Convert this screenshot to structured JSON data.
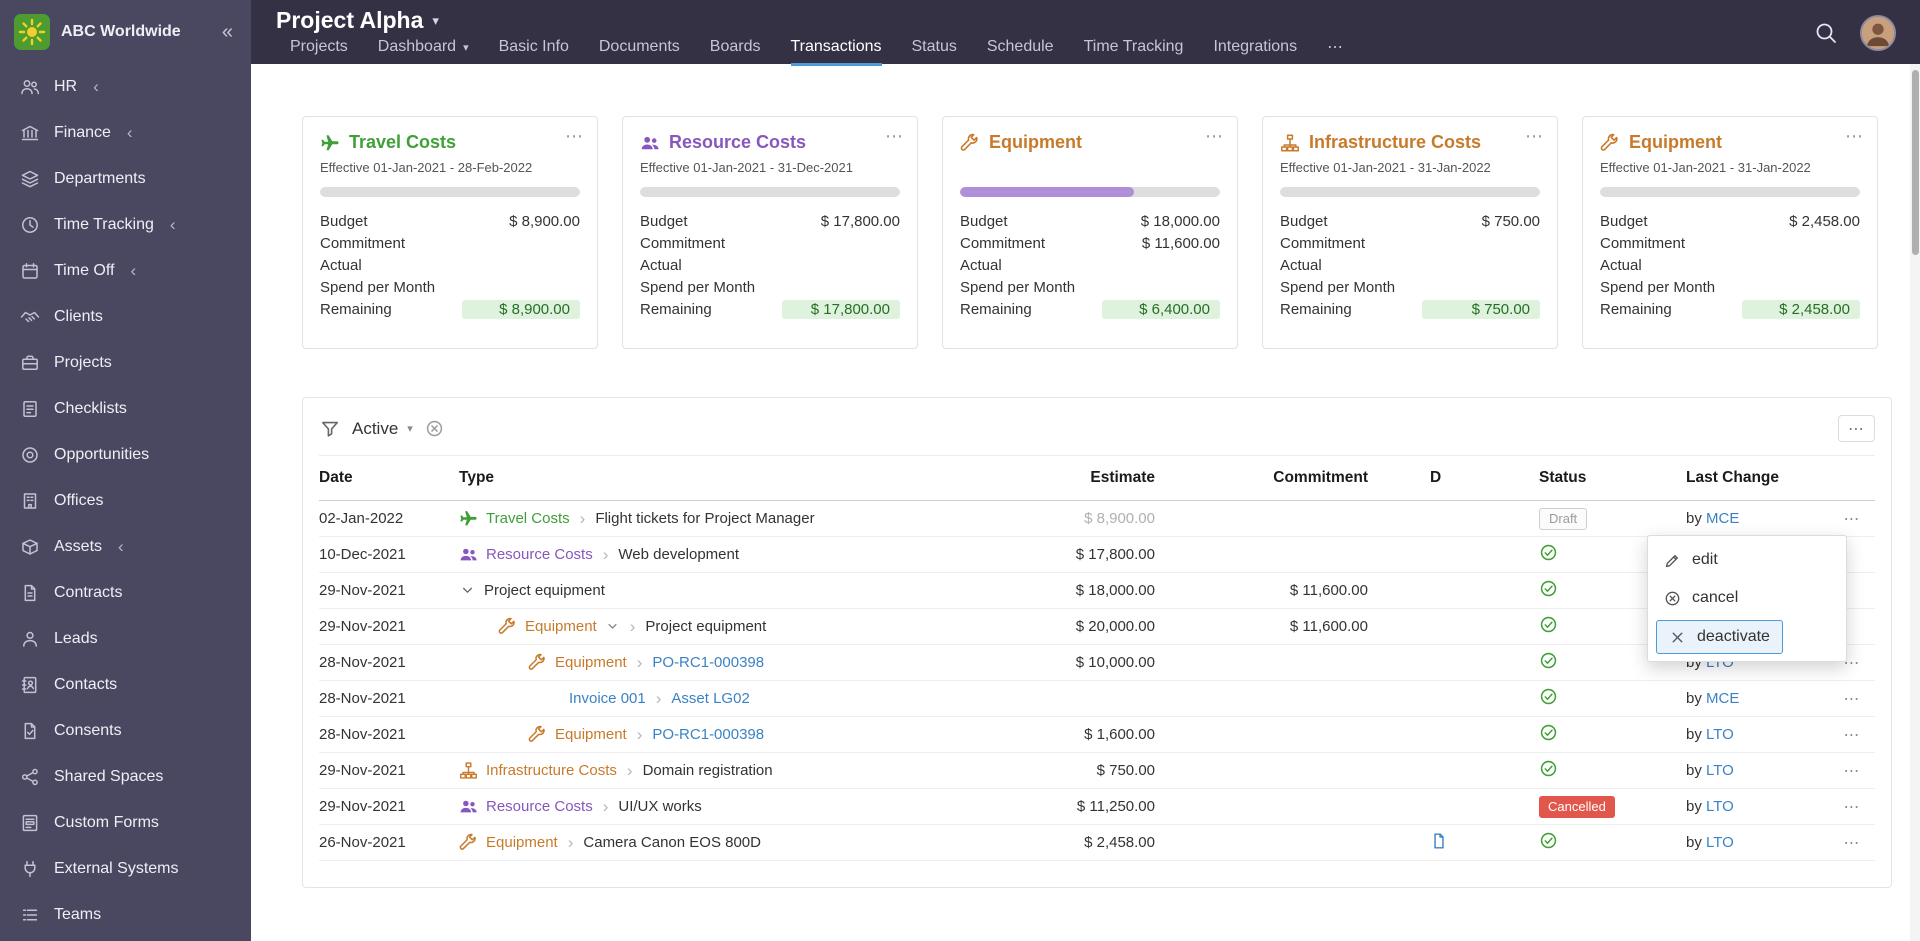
{
  "brand": {
    "name": "ABC Worldwide"
  },
  "icons": {
    "more": "⋯",
    "caret_down": "▾",
    "chevron_separator": "›",
    "collapse": "«",
    "submenu_collapsed": "‹"
  },
  "sidebar": {
    "items": [
      {
        "label": "HR",
        "collapsible": true
      },
      {
        "label": "Finance",
        "collapsible": true
      },
      {
        "label": "Departments"
      },
      {
        "label": "Time Tracking",
        "collapsible": true
      },
      {
        "label": "Time Off",
        "collapsible": true
      },
      {
        "label": "Clients"
      },
      {
        "label": "Projects"
      },
      {
        "label": "Checklists"
      },
      {
        "label": "Opportunities"
      },
      {
        "label": "Offices"
      },
      {
        "label": "Assets",
        "collapsible": true
      },
      {
        "label": "Contracts"
      },
      {
        "label": "Leads"
      },
      {
        "label": "Contacts"
      },
      {
        "label": "Consents"
      },
      {
        "label": "Shared Spaces"
      },
      {
        "label": "Custom Forms"
      },
      {
        "label": "External Systems"
      },
      {
        "label": "Teams"
      }
    ]
  },
  "header": {
    "project_title": "Project Alpha",
    "tabs": [
      {
        "label": "Projects"
      },
      {
        "label": "Dashboard",
        "has_caret": true
      },
      {
        "label": "Basic Info"
      },
      {
        "label": "Documents"
      },
      {
        "label": "Boards"
      },
      {
        "label": "Transactions",
        "active": true
      },
      {
        "label": "Status"
      },
      {
        "label": "Schedule"
      },
      {
        "label": "Time Tracking"
      },
      {
        "label": "Integrations"
      }
    ]
  },
  "card_labels": {
    "budget": "Budget",
    "commitment": "Commitment",
    "actual": "Actual",
    "spend": "Spend per Month",
    "remaining": "Remaining"
  },
  "cards": [
    {
      "title": "Travel Costs",
      "icon": "plane",
      "effective": "Effective 01-Jan-2021 - 28-Feb-2022",
      "progress": 0,
      "budget": "$ 8,900.00",
      "commitment": "",
      "actual": "",
      "spend": "",
      "remaining": "$ 8,900.00"
    },
    {
      "title": "Resource Costs",
      "icon": "users",
      "effective": "Effective 01-Jan-2021 - 31-Dec-2021",
      "progress": 0,
      "budget": "$ 17,800.00",
      "commitment": "",
      "actual": "",
      "spend": "",
      "remaining": "$ 17,800.00"
    },
    {
      "title": "Equipment",
      "icon": "wrench",
      "effective": "",
      "progress": 67,
      "budget": "$ 18,000.00",
      "commitment": "$ 11,600.00",
      "actual": "",
      "spend": "",
      "remaining": "$ 6,400.00"
    },
    {
      "title": "Infrastructure Costs",
      "icon": "sitemap",
      "effective": "Effective 01-Jan-2021 - 31-Jan-2022",
      "progress": 0,
      "budget": "$ 750.00",
      "commitment": "",
      "actual": "",
      "spend": "",
      "remaining": "$ 750.00"
    },
    {
      "title": "Equipment",
      "icon": "wrench",
      "effective": "Effective 01-Jan-2021 - 31-Jan-2022",
      "progress": 0,
      "budget": "$ 2,458.00",
      "commitment": "",
      "actual": "",
      "spend": "",
      "remaining": "$ 2,458.00"
    }
  ],
  "filter": {
    "label": "Active"
  },
  "table": {
    "columns": [
      "Date",
      "Type",
      "Estimate",
      "Commitment",
      "D",
      "Status",
      "Last Change"
    ],
    "by_label": "by",
    "rows": [
      {
        "date": "02-Jan-2022",
        "type": "Travel Costs",
        "desc": "Flight tickets for Project Manager",
        "estimate": "$ 8,900.00",
        "commitment": "",
        "status": "Draft",
        "by": "MCE"
      },
      {
        "date": "10-Dec-2021",
        "type": "Resource Costs",
        "desc": "Web development",
        "estimate": "$ 17,800.00",
        "commitment": "",
        "status": "approved",
        "by": ""
      },
      {
        "date": "29-Nov-2021",
        "desc": "Project equipment",
        "estimate": "$ 18,000.00",
        "commitment": "$ 11,600.00",
        "status": "approved",
        "by": ""
      },
      {
        "date": "29-Nov-2021",
        "type": "Equipment",
        "desc": "Project equipment",
        "estimate": "$ 20,000.00",
        "commitment": "$ 11,600.00",
        "status": "approved",
        "by": ""
      },
      {
        "date": "28-Nov-2021",
        "type": "Equipment",
        "link": "PO-RC1-000398",
        "estimate": "$ 10,000.00",
        "commitment": "",
        "status": "approved",
        "by": "LTO"
      },
      {
        "date": "28-Nov-2021",
        "link": "Invoice 001",
        "link2": "Asset LG02",
        "estimate": "",
        "commitment": "",
        "status": "approved",
        "by": "MCE"
      },
      {
        "date": "28-Nov-2021",
        "type": "Equipment",
        "link": "PO-RC1-000398",
        "estimate": "$ 1,600.00",
        "commitment": "",
        "status": "approved",
        "by": "LTO"
      },
      {
        "date": "29-Nov-2021",
        "type": "Infrastructure Costs",
        "desc": "Domain registration",
        "estimate": "$ 750.00",
        "commitment": "",
        "status": "approved",
        "by": "LTO"
      },
      {
        "date": "29-Nov-2021",
        "type": "Resource Costs",
        "desc": "UI/UX works",
        "estimate": "$ 11,250.00",
        "commitment": "",
        "status": "Cancelled",
        "by": "LTO"
      },
      {
        "date": "26-Nov-2021",
        "type": "Equipment",
        "desc": "Camera Canon EOS 800D",
        "estimate": "$ 2,458.00",
        "commitment": "",
        "status": "approved",
        "by": "LTO",
        "has_document": true
      }
    ]
  },
  "context_menu": {
    "items": [
      {
        "label": "edit"
      },
      {
        "label": "cancel"
      },
      {
        "label": "deactivate",
        "focused": true
      }
    ]
  },
  "colors": {
    "sidebar_bg": "#4A4860",
    "topbar_bg": "#343145",
    "green": "#3FA037",
    "purple": "#8757BE",
    "orange": "#C87A2B",
    "link_blue": "#3B82C4",
    "tab_accent": "#4D9BD6",
    "cancelled_red": "#E2574C",
    "remaining_chip_bg": "#DFF2DD",
    "progress_purple": "#B08FD8",
    "logo_green": "#4E9C2F",
    "logo_sun_yellow": "#F2CF2A"
  }
}
